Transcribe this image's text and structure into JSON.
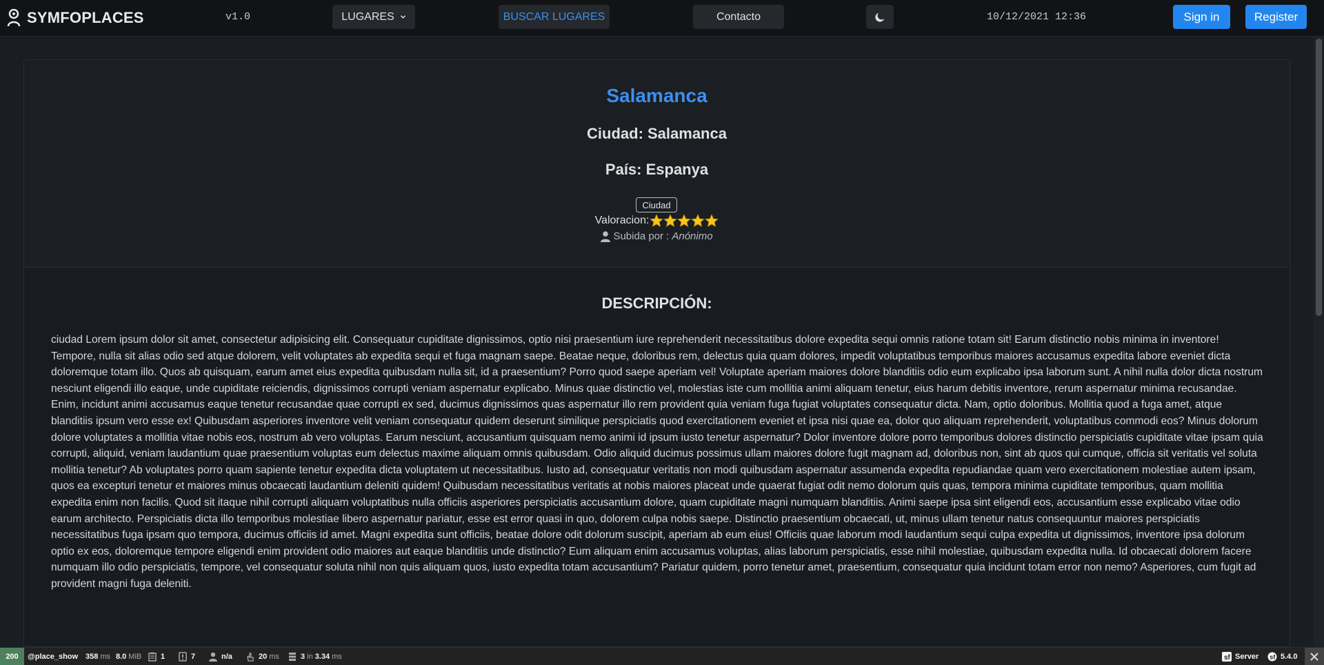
{
  "navbar": {
    "brand": "SYMFOPLACES",
    "version": "v1.0",
    "menu_lugares": "LUGARES",
    "menu_buscar": "BUSCAR LUGARES",
    "menu_contacto": "Contacto",
    "theme_icon": "moon-icon",
    "datetime": "10/12/2021 12:36",
    "sign_in": "Sign in",
    "register": "Register"
  },
  "place": {
    "name": "Salamanca",
    "city_line": "Ciudad: Salamanca",
    "country_line": "País: Espanya",
    "type_badge": "Ciudad",
    "rating_label": "Valoracion:",
    "rating": 5,
    "rating_max": 5,
    "uploaded_by_label": "Subida por :",
    "uploaded_by": "Anónimo"
  },
  "description": {
    "title": "DESCRIPCIÓN:",
    "text": "ciudad Lorem ipsum dolor sit amet, consectetur adipisicing elit. Consequatur cupiditate dignissimos, optio nisi praesentium iure reprehenderit necessitatibus dolore expedita sequi omnis ratione totam sit! Earum distinctio nobis minima in inventore! Tempore, nulla sit alias odio sed atque dolorem, velit voluptates ab expedita sequi et fuga magnam saepe. Beatae neque, doloribus rem, delectus quia quam dolores, impedit voluptatibus temporibus maiores accusamus expedita labore eveniet dicta doloremque totam illo. Quos ab quisquam, earum amet eius expedita quibusdam nulla sit, id a praesentium? Porro quod saepe aperiam vel! Voluptate aperiam maiores dolore blanditiis odio eum explicabo ipsa laborum sunt. A nihil nulla dolor dicta nostrum nesciunt eligendi illo eaque, unde cupiditate reiciendis, dignissimos corrupti veniam aspernatur explicabo. Minus quae distinctio vel, molestias iste cum mollitia animi aliquam tenetur, eius harum debitis inventore, rerum aspernatur minima recusandae. Enim, incidunt animi accusamus eaque tenetur recusandae quae corrupti ex sed, ducimus dignissimos quas aspernatur illo rem provident quia veniam fuga fugiat voluptates consequatur dicta. Nam, optio doloribus. Mollitia quod a fuga amet, atque blanditiis ipsum vero esse ex! Quibusdam asperiores inventore velit veniam consequatur quidem deserunt similique perspiciatis quod exercitationem eveniet et ipsa nisi quae ea, dolor quo aliquam reprehenderit, voluptatibus commodi eos? Minus dolorum dolore voluptates a mollitia vitae nobis eos, nostrum ab vero voluptas. Earum nesciunt, accusantium quisquam nemo animi id ipsum iusto tenetur aspernatur? Dolor inventore dolore porro temporibus dolores distinctio perspiciatis cupiditate vitae ipsam quia corrupti, aliquid, veniam laudantium quae praesentium voluptas eum delectus maxime aliquam omnis quibusdam. Odio aliquid ducimus possimus ullam maiores dolore fugit magnam ad, doloribus non, sint ab quos qui cumque, officia sit veritatis vel soluta mollitia tenetur? Ab voluptates porro quam sapiente tenetur expedita dicta voluptatem ut necessitatibus. Iusto ad, consequatur veritatis non modi quibusdam aspernatur assumenda expedita repudiandae quam vero exercitationem molestiae autem ipsam, quos ea excepturi tenetur et maiores minus obcaecati laudantium deleniti quidem! Quibusdam necessitatibus veritatis at nobis maiores placeat unde quaerat fugiat odit nemo dolorum quis quas, tempora minima cupiditate temporibus, quam mollitia expedita enim non facilis. Quod sit itaque nihil corrupti aliquam voluptatibus nulla officiis asperiores perspiciatis accusantium dolore, quam cupiditate magni numquam blanditiis. Animi saepe ipsa sint eligendi eos, accusantium esse explicabo vitae odio earum architecto. Perspiciatis dicta illo temporibus molestiae libero aspernatur pariatur, esse est error quasi in quo, dolorem culpa nobis saepe. Distinctio praesentium obcaecati, ut, minus ullam tenetur natus consequuntur maiores perspiciatis necessitatibus fuga ipsam quo tempora, ducimus officiis id amet. Magni expedita sunt officiis, beatae dolore odit dolorum suscipit, aperiam ab eum eius! Officiis quae laborum modi laudantium sequi culpa expedita ut dignissimos, inventore ipsa dolorum optio ex eos, doloremque tempore eligendi enim provident odio maiores aut eaque blanditiis unde distinctio? Eum aliquam enim accusamus voluptas, alias laborum perspiciatis, esse nihil molestiae, quibusdam expedita nulla. Id obcaecati dolorem facere numquam illo odio perspiciatis, tempore, vel consequatur soluta nihil non quis aliquam quos, iusto expedita totam accusantium? Pariatur quidem, porro tenetur amet, praesentium, consequatur quia incidunt totam error non nemo? Asperiores, cum fugit ad provident magni fuga deleniti."
  },
  "debug_toolbar": {
    "status_code": "200",
    "route": "@place_show",
    "time_value": "358",
    "time_unit": "ms",
    "memory_value": "8.0",
    "memory_unit": "MiB",
    "forms_count": "1",
    "validator_count": "7",
    "user": "n/a",
    "events_value": "20",
    "events_unit": "ms",
    "db_queries": "3",
    "db_in": "in",
    "db_time": "3.34",
    "db_unit": "ms",
    "server_label": "Server",
    "symfony_version": "5.4.0"
  },
  "colors": {
    "accent": "#3d8fef",
    "primary_button": "#2386ef",
    "status_ok": "#4f805d",
    "star": "#f5c518"
  }
}
